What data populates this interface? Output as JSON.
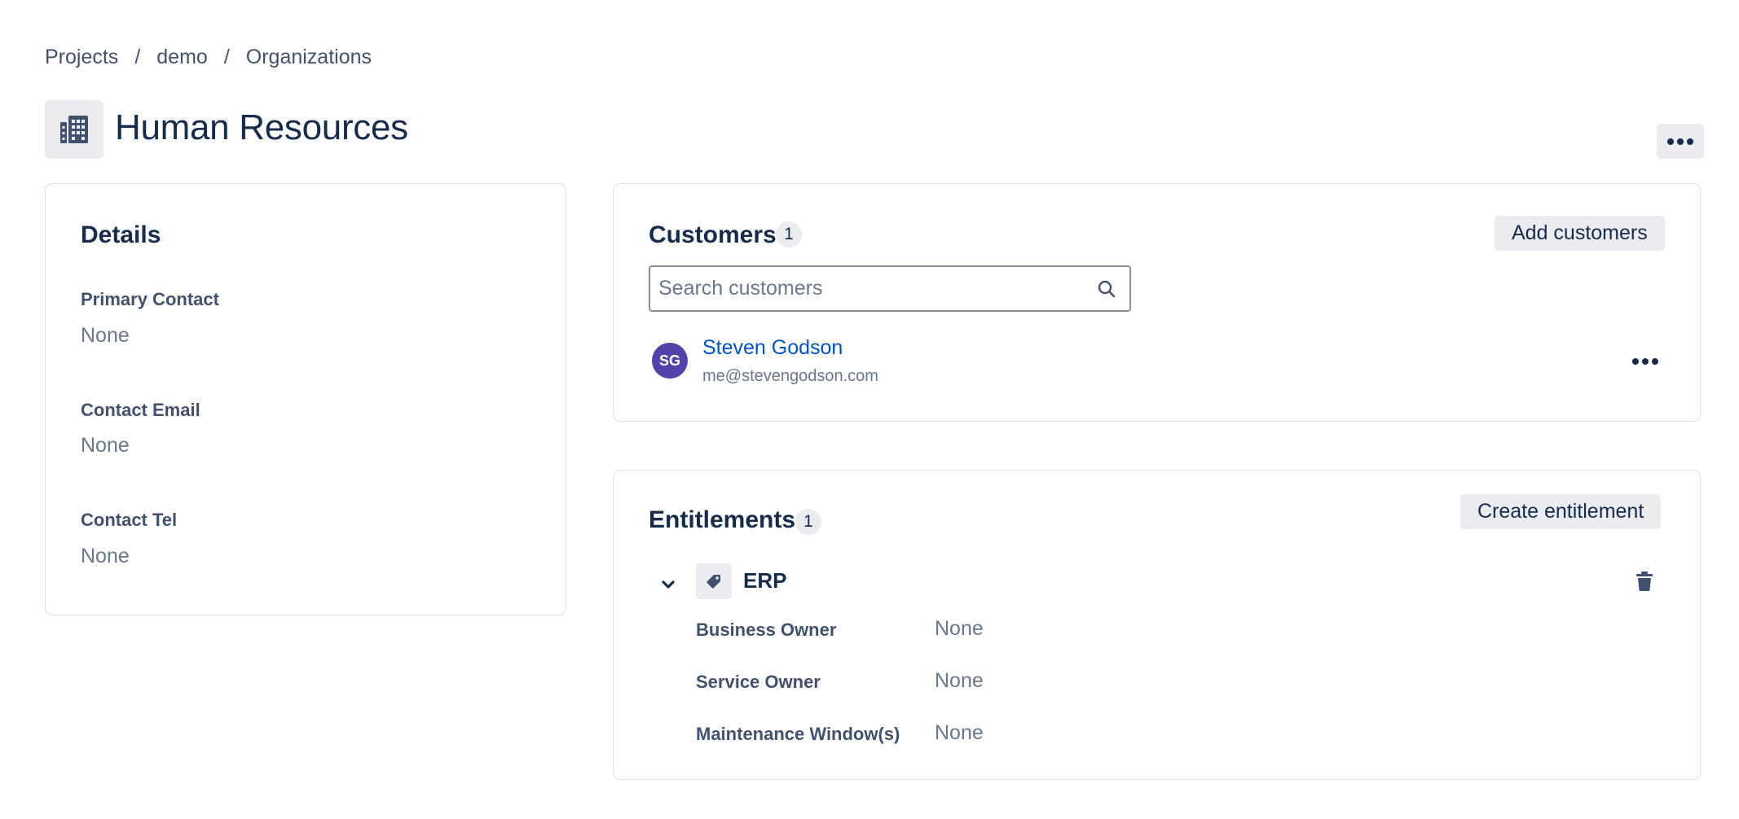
{
  "breadcrumb": {
    "items": [
      "Projects",
      "demo",
      "Organizations"
    ],
    "separator": "/"
  },
  "header": {
    "icon": "building-icon",
    "title": "Human Resources",
    "more_icon": "more-horizontal-icon"
  },
  "details": {
    "heading": "Details",
    "fields": [
      {
        "label": "Primary Contact",
        "value": "None"
      },
      {
        "label": "Contact Email",
        "value": "None"
      },
      {
        "label": "Contact Tel",
        "value": "None"
      }
    ]
  },
  "customers": {
    "heading": "Customers",
    "count": "1",
    "add_button": "Add customers",
    "search_placeholder": "Search customers",
    "items": [
      {
        "initials": "SG",
        "name": "Steven Godson",
        "email": "me@stevengodson.com",
        "avatar_color": "#5243aa"
      }
    ]
  },
  "entitlements": {
    "heading": "Entitlements",
    "count": "1",
    "create_button": "Create entitlement",
    "items": [
      {
        "name": "ERP",
        "icon": "tag-icon",
        "fields": [
          {
            "label": "Business Owner",
            "value": "None"
          },
          {
            "label": "Service Owner",
            "value": "None"
          },
          {
            "label": "Maintenance Window(s)",
            "value": "None"
          }
        ]
      }
    ]
  },
  "colors": {
    "text_primary": "#172b4d",
    "text_secondary": "#42526e",
    "text_muted": "#6b778c",
    "link": "#0052cc",
    "button_bg": "#ebecf0",
    "border": "#dfe1e6"
  }
}
